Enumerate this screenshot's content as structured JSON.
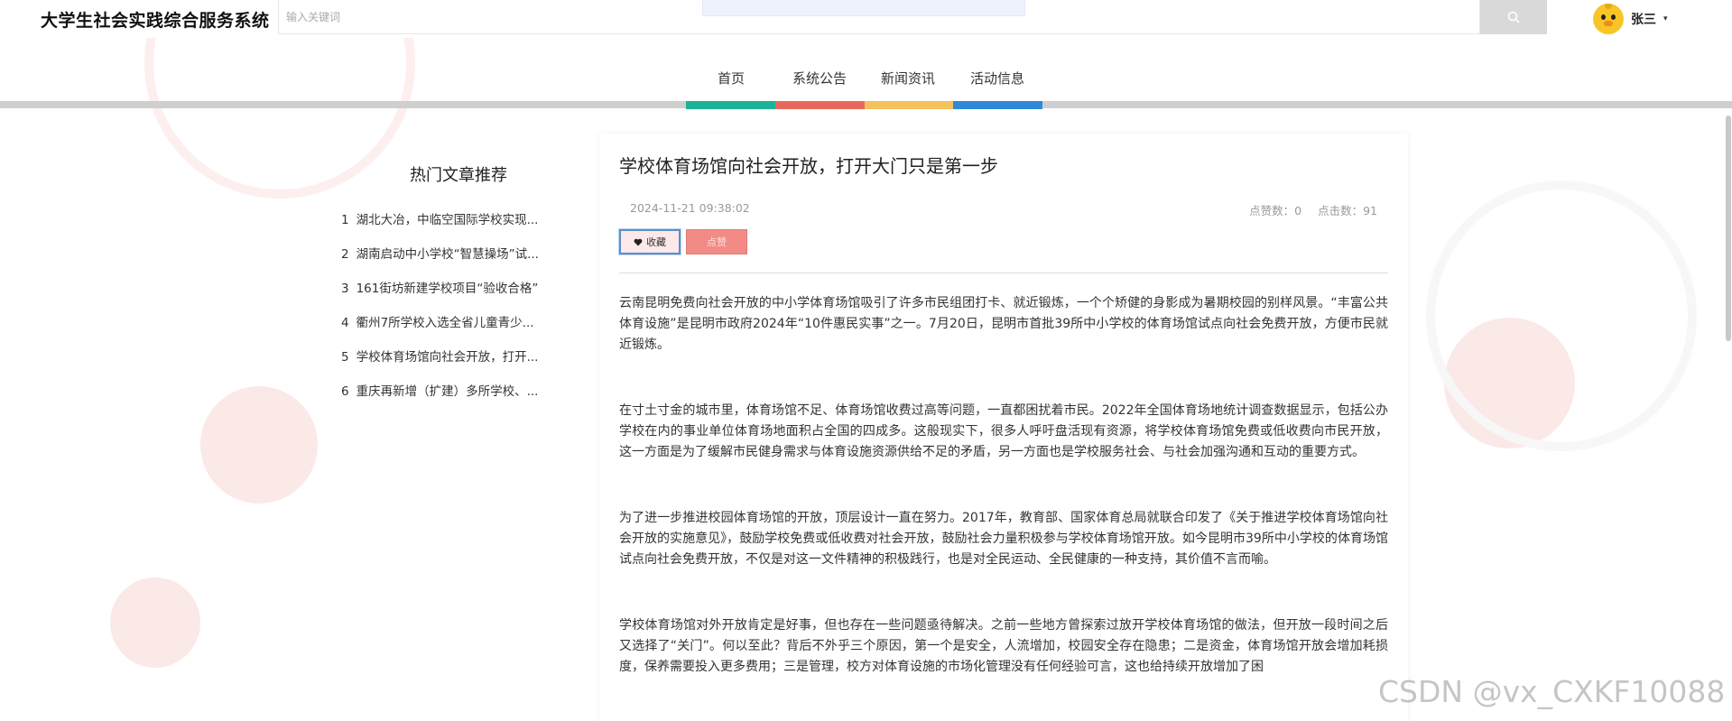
{
  "header": {
    "site_title": "大学生社会实践综合服务系统",
    "search_placeholder": "输入关键词",
    "search_icon": "search-icon",
    "user_name": "张三",
    "user_caret": "▾"
  },
  "nav": {
    "items": [
      "首页",
      "系统公告",
      "新闻资讯",
      "活动信息"
    ],
    "colors": [
      "#1ab394",
      "#e9685d",
      "#f4c15d",
      "#2e8ad8"
    ]
  },
  "sidebar": {
    "title": "热门文章推荐",
    "items": [
      {
        "index": "1",
        "title": "湖北大冶，中临空国际学校实现..."
      },
      {
        "index": "2",
        "title": "湖南启动中小学校“智慧操场”试..."
      },
      {
        "index": "3",
        "title": "161街坊新建学校项目“验收合格”"
      },
      {
        "index": "4",
        "title": "衢州7所学校入选全省儿童青少..."
      },
      {
        "index": "5",
        "title": "学校体育场馆向社会开放，打开..."
      },
      {
        "index": "6",
        "title": "重庆再新增（扩建）多所学校、..."
      }
    ]
  },
  "article": {
    "title": "学校体育场馆向社会开放，打开大门只是第一步",
    "date": "2024-11-21 09:38:02",
    "likes_label": "点赞数：0",
    "clicks_label": "点击数：91",
    "collect_label": "收藏",
    "like_label": "点赞",
    "paragraphs": [
      "云南昆明免费向社会开放的中小学体育场馆吸引了许多市民组团打卡、就近锻炼，一个个矫健的身影成为暑期校园的别样风景。“丰富公共体育设施”是昆明市政府2024年“10件惠民实事”之一。7月20日，昆明市首批39所中小学校的体育场馆试点向社会免费开放，方便市民就近锻炼。",
      "在寸土寸金的城市里，体育场馆不足、体育场馆收费过高等问题，一直都困扰着市民。2022年全国体育场地统计调查数据显示，包括公办学校在内的事业单位体育场地面积占全国的四成多。这般现实下，很多人呼吁盘活现有资源，将学校体育场馆免费或低收费向市民开放，这一方面是为了缓解市民健身需求与体育设施资源供给不足的矛盾，另一方面也是学校服务社会、与社会加强沟通和互动的重要方式。",
      "为了进一步推进校园体育场馆的开放，顶层设计一直在努力。2017年，教育部、国家体育总局就联合印发了《关于推进学校体育场馆向社会开放的实施意见》，鼓励学校免费或低收费对社会开放，鼓励社会力量积极参与学校体育场馆开放。如今昆明市39所中小学校的体育场馆试点向社会免费开放，不仅是对这一文件精神的积极践行，也是对全民运动、全民健康的一种支持，其价值不言而喻。",
      "学校体育场馆对外开放肯定是好事，但也存在一些问题亟待解决。之前一些地方曾探索过放开学校体育场馆的做法，但开放一段时间之后又选择了“关门”。何以至此？背后不外乎三个原因，第一个是安全，人流增加，校园安全存在隐患；二是资金，体育场馆开放会增加耗损度，保养需要投入更多费用；三是管理，校方对体育设施的市场化管理没有任何经验可言，这也给持续开放增加了困"
    ]
  },
  "watermark": "CSDN @vx_CXKF10088"
}
